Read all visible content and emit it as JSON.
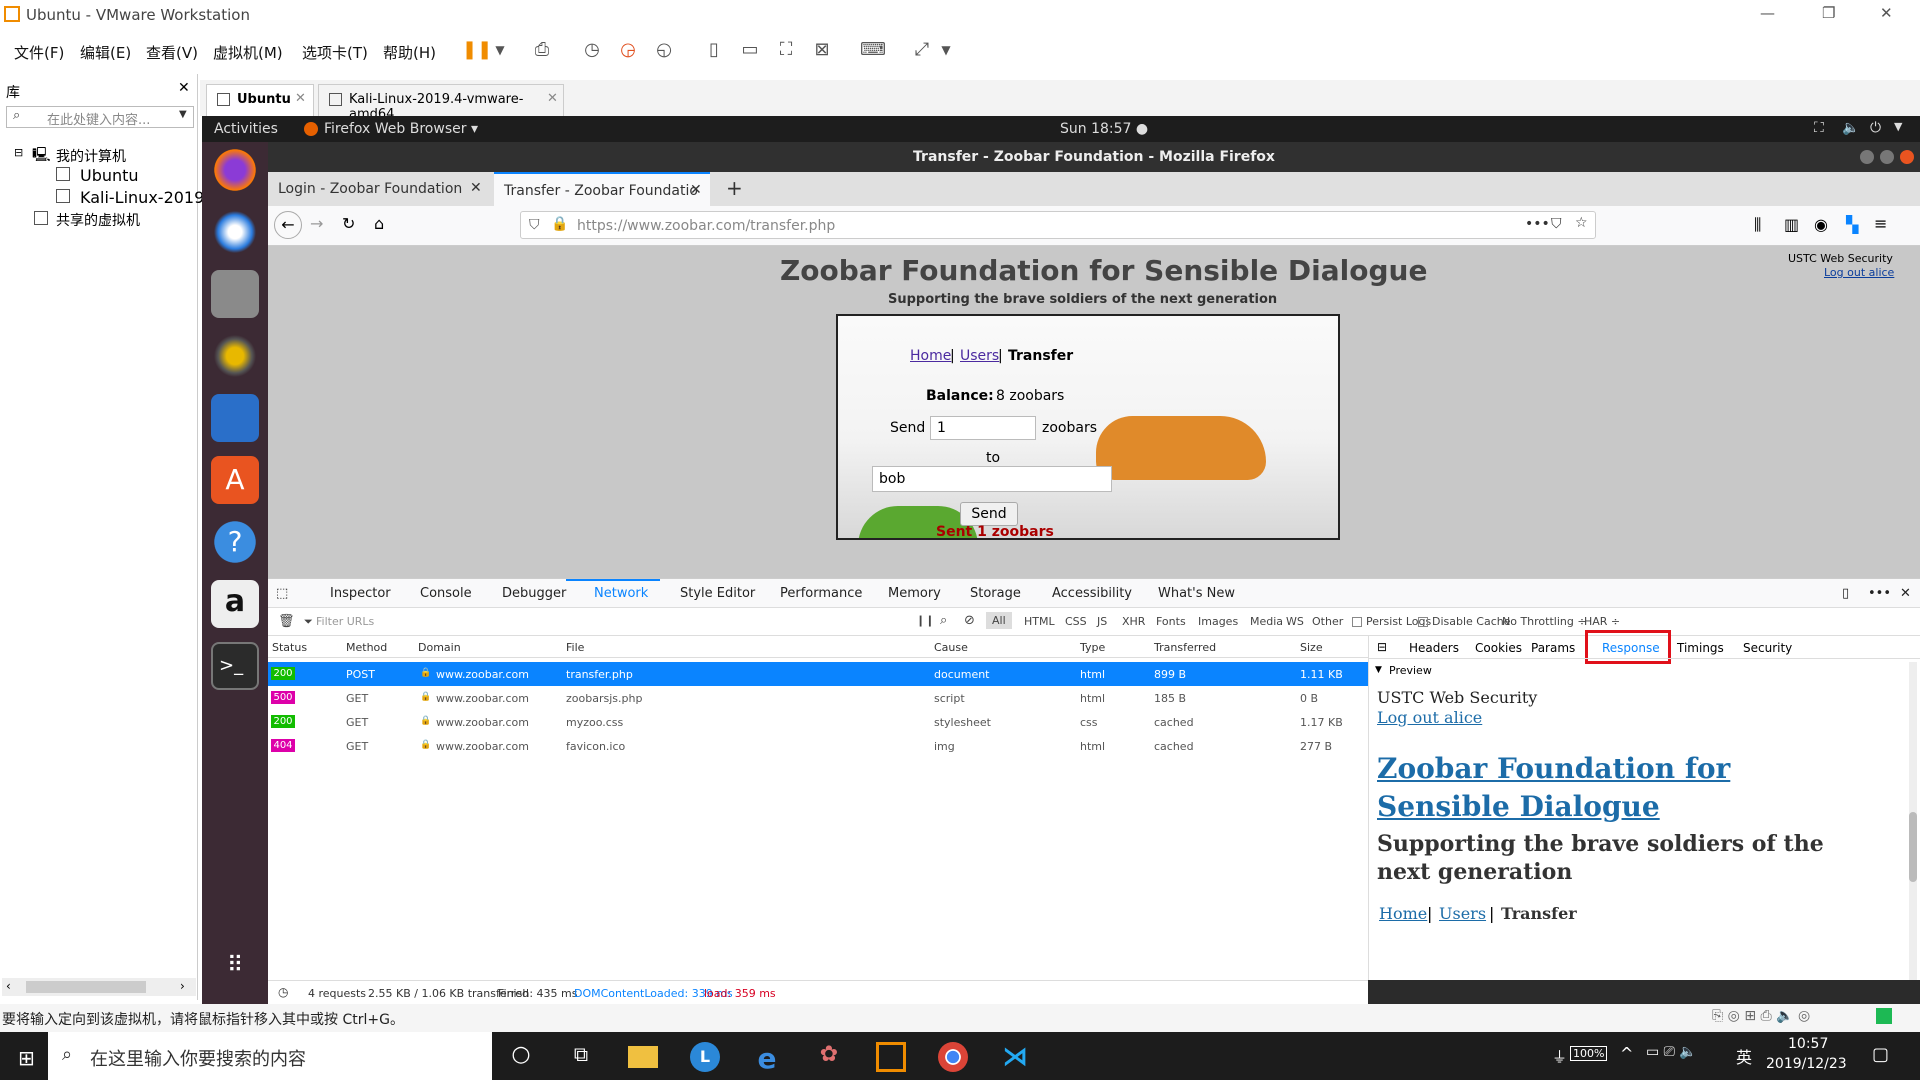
{
  "vmware": {
    "title": "Ubuntu - VMware Workstation",
    "menu": [
      "文件(F)",
      "编辑(E)",
      "查看(V)",
      "虚拟机(M)",
      "选项卡(T)",
      "帮助(H)"
    ],
    "library": {
      "title": "库",
      "search_placeholder": "在此处键入内容...",
      "tree": [
        "我的计算机",
        "Ubuntu",
        "Kali-Linux-2019.",
        "共享的虚拟机"
      ]
    },
    "tabs": [
      "Ubuntu",
      "Kali-Linux-2019.4-vmware-amd64"
    ],
    "status_text": "要将输入定向到该虚拟机，请将鼠标指针移入其中或按 Ctrl+G。"
  },
  "ubuntu": {
    "activities": "Activities",
    "app_menu": "Firefox Web Browser ▾",
    "clock": "Sun 18:57 ●"
  },
  "firefox": {
    "window_title": "Transfer - Zoobar Foundation - Mozilla Firefox",
    "tabs": [
      "Login - Zoobar Foundation",
      "Transfer - Zoobar Foundatio"
    ],
    "url": "https://www.zoobar.com/transfer.php"
  },
  "page": {
    "header_right": "USTC Web Security",
    "logout": "Log out alice",
    "title": "Zoobar Foundation for Sensible Dialogue",
    "subtitle": "Supporting the brave soldiers of the next generation",
    "nav": {
      "home": "Home",
      "users": "Users",
      "sep": "|",
      "current": "Transfer"
    },
    "balance_label": "Balance:",
    "balance_value": "8 zoobars",
    "send_label": "Send",
    "amount": "1",
    "unit": "zoobars",
    "to_label": "to",
    "recipient": "bob",
    "send_button": "Send",
    "result": "Sent 1 zoobars"
  },
  "devtools": {
    "tabs": [
      "Inspector",
      "Console",
      "Debugger",
      "Network",
      "Style Editor",
      "Performance",
      "Memory",
      "Storage",
      "Accessibility",
      "What's New"
    ],
    "filter_placeholder": "Filter URLs",
    "types": [
      "All",
      "HTML",
      "CSS",
      "JS",
      "XHR",
      "Fonts",
      "Images",
      "Media",
      "WS",
      "Other"
    ],
    "persist": "Persist Logs",
    "disable_cache": "Disable Cache",
    "throttling": "No Throttling ÷",
    "har": "HAR ÷",
    "columns": [
      "Status",
      "Method",
      "Domain",
      "File",
      "Cause",
      "Type",
      "Transferred",
      "Size"
    ],
    "requests": [
      {
        "status": "200",
        "method": "POST",
        "domain": "www.zoobar.com",
        "file": "transfer.php",
        "cause": "document",
        "type": "html",
        "transferred": "899 B",
        "size": "1.11 KB"
      },
      {
        "status": "500",
        "method": "GET",
        "domain": "www.zoobar.com",
        "file": "zoobarsjs.php",
        "cause": "script",
        "type": "html",
        "transferred": "185 B",
        "size": "0 B"
      },
      {
        "status": "200",
        "method": "GET",
        "domain": "www.zoobar.com",
        "file": "myzoo.css",
        "cause": "stylesheet",
        "type": "css",
        "transferred": "cached",
        "size": "1.17 KB"
      },
      {
        "status": "404",
        "method": "GET",
        "domain": "www.zoobar.com",
        "file": "favicon.ico",
        "cause": "img",
        "type": "html",
        "transferred": "cached",
        "size": "277 B"
      }
    ],
    "side_tabs": [
      "Headers",
      "Cookies",
      "Params",
      "Response",
      "Timings",
      "Security"
    ],
    "preview_label": "Preview",
    "preview": {
      "header": "USTC Web Security",
      "logout": "Log out alice",
      "title": "Zoobar Foundation for Sensible Dialogue",
      "subtitle": "Supporting the brave soldiers of the next generation",
      "home": "Home",
      "users": "Users",
      "current": "Transfer"
    },
    "status": {
      "requests": "4 requests",
      "size": "2.55 KB / 1.06 KB transferred",
      "finish": "Finish: 435 ms",
      "dcl": "DOMContentLoaded: 339 ms",
      "load": "load: 359 ms"
    }
  },
  "taskbar": {
    "search_placeholder": "在这里输入你要搜索的内容",
    "battery": "100%",
    "ime": "英",
    "time": "10:57",
    "date": "2019/12/23"
  }
}
